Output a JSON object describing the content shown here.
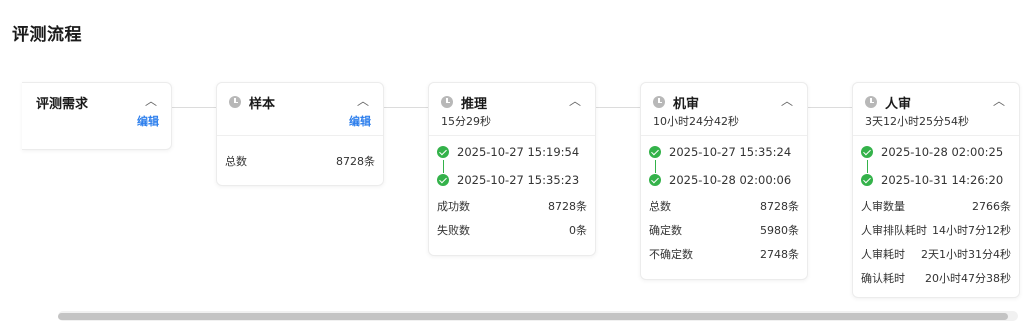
{
  "page": {
    "title": "评测流程"
  },
  "stages": [
    {
      "title": "评测需求",
      "edit_label": "编辑"
    },
    {
      "title": "样本",
      "edit_label": "编辑",
      "rows": [
        {
          "label": "总数",
          "value": "8728条"
        }
      ]
    },
    {
      "title": "推理",
      "duration": "15分29秒",
      "start": "2025-10-27 15:19:54",
      "end": "2025-10-27 15:35:23",
      "rows": [
        {
          "label": "成功数",
          "value": "8728条"
        },
        {
          "label": "失败数",
          "value": "0条"
        }
      ]
    },
    {
      "title": "机审",
      "duration": "10小时24分42秒",
      "start": "2025-10-27 15:35:24",
      "end": "2025-10-28 02:00:06",
      "rows": [
        {
          "label": "总数",
          "value": "8728条"
        },
        {
          "label": "确定数",
          "value": "5980条"
        },
        {
          "label": "不确定数",
          "value": "2748条"
        }
      ]
    },
    {
      "title": "人审",
      "duration": "3天12小时25分54秒",
      "start": "2025-10-28 02:00:25",
      "end": "2025-10-31 14:26:20",
      "rows": [
        {
          "label": "人审数量",
          "value": "2766条"
        },
        {
          "label": "人审排队耗时",
          "value": "14小时7分12秒"
        },
        {
          "label": "人审耗时",
          "value": "2天1小时31分4秒"
        },
        {
          "label": "确认耗时",
          "value": "20小时47分38秒"
        }
      ]
    }
  ],
  "icons": {
    "stage": "clock-icon",
    "collapse": "chevron-up-icon",
    "done": "check-circle-icon"
  },
  "colors": {
    "link": "#2f80ed",
    "success": "#34b24a"
  }
}
